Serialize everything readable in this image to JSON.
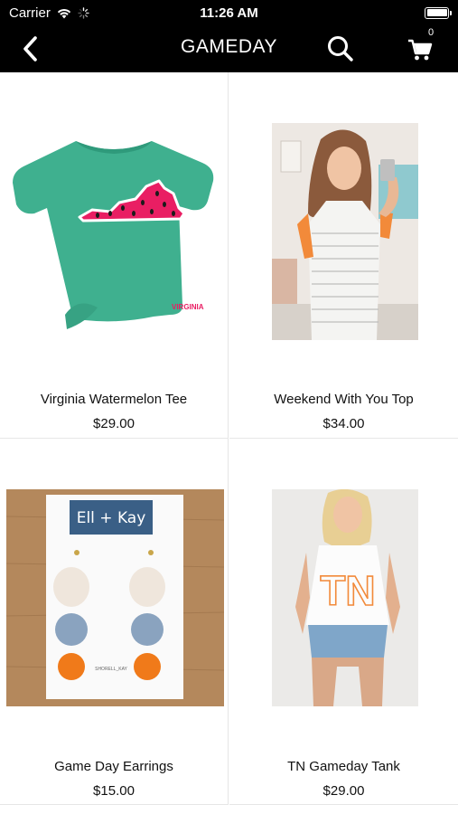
{
  "status_bar": {
    "carrier": "Carrier",
    "time": "11:26 AM"
  },
  "nav": {
    "title": "GAMEDAY",
    "cart_count": "0"
  },
  "products": [
    {
      "name": "Virginia Watermelon Tee",
      "price": "$29.00",
      "image_text": "VIRGINIA"
    },
    {
      "name": "Weekend With You Top",
      "price": "$34.00"
    },
    {
      "name": "Game Day Earrings",
      "price": "$15.00",
      "image_text": "Ell + Kay",
      "image_subtext": "SHORELL_KAY"
    },
    {
      "name": "TN Gameday Tank",
      "price": "$29.00",
      "image_text": "TN"
    }
  ],
  "icons": {
    "back": "chevron-left-icon",
    "search": "search-icon",
    "cart": "cart-icon",
    "wifi": "wifi-icon",
    "spinner": "activity-spinner-icon",
    "battery": "battery-icon"
  },
  "colors": {
    "bar_background": "#000000",
    "bar_text": "#ffffff",
    "divider": "#e6e6e6"
  }
}
